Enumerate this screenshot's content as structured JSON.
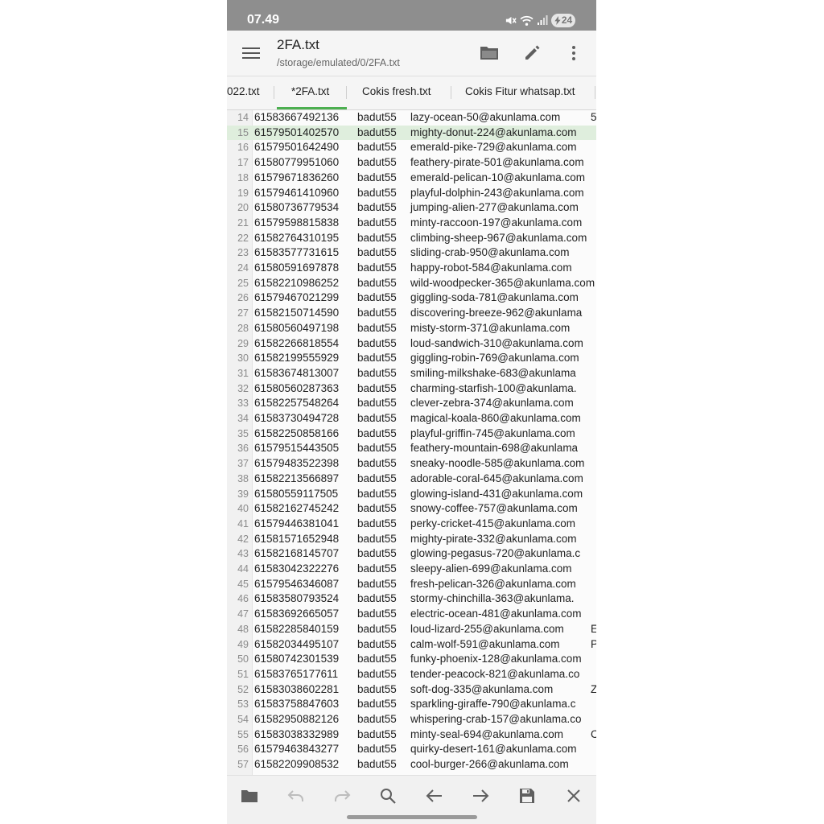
{
  "status_bar": {
    "time": "07.49",
    "battery": "24"
  },
  "app_bar": {
    "title": "2FA.txt",
    "path": "/storage/emulated/0/2FA.txt"
  },
  "tabs": [
    {
      "label": "022.txt",
      "active": false
    },
    {
      "label": "*2FA.txt",
      "active": true
    },
    {
      "label": "Cokis fresh.txt",
      "active": false
    },
    {
      "label": "Cokis Fitur whatsap.txt",
      "active": false
    }
  ],
  "editor": {
    "highlighted_line": "15",
    "lines": [
      [
        "14",
        "61583667492136",
        "badut55",
        "lazy-ocean-50@akunlama.com",
        "5"
      ],
      [
        "15",
        "61579501402570",
        "badut55",
        "mighty-donut-224@akunlama.com",
        ""
      ],
      [
        "16",
        "61579501642490",
        "badut55",
        "emerald-pike-729@akunlama.com",
        ""
      ],
      [
        "17",
        "61580779951060",
        "badut55",
        "feathery-pirate-501@akunlama.com",
        ""
      ],
      [
        "18",
        "61579671836260",
        "badut55",
        "emerald-pelican-10@akunlama.com",
        ""
      ],
      [
        "19",
        "61579461410960",
        "badut55",
        "playful-dolphin-243@akunlama.com",
        ""
      ],
      [
        "20",
        "61580736779534",
        "badut55",
        "jumping-alien-277@akunlama.com",
        ""
      ],
      [
        "21",
        "61579598815838",
        "badut55",
        "minty-raccoon-197@akunlama.com",
        ""
      ],
      [
        "22",
        "61582764310195",
        "badut55",
        "climbing-sheep-967@akunlama.com",
        ""
      ],
      [
        "23",
        "61583577731615",
        "badut55",
        "sliding-crab-950@akunlama.com",
        ""
      ],
      [
        "24",
        "61580591697878",
        "badut55",
        "happy-robot-584@akunlama.com",
        ""
      ],
      [
        "25",
        "61582210986252",
        "badut55",
        "wild-woodpecker-365@akunlama.com",
        ""
      ],
      [
        "26",
        "61579467021299",
        "badut55",
        "giggling-soda-781@akunlama.com",
        ""
      ],
      [
        "27",
        "61582150714590",
        "badut55",
        "discovering-breeze-962@akunlama",
        ""
      ],
      [
        "28",
        "61580560497198",
        "badut55",
        "misty-storm-371@akunlama.com",
        ""
      ],
      [
        "29",
        "61582266818554",
        "badut55",
        "loud-sandwich-310@akunlama.com",
        ""
      ],
      [
        "30",
        "61582199555929",
        "badut55",
        "giggling-robin-769@akunlama.com",
        ""
      ],
      [
        "31",
        "61583674813007",
        "badut55",
        "smiling-milkshake-683@akunlama",
        ""
      ],
      [
        "32",
        "61580560287363",
        "badut55",
        "charming-starfish-100@akunlama.",
        ""
      ],
      [
        "33",
        "61582257548264",
        "badut55",
        "clever-zebra-374@akunlama.com",
        ""
      ],
      [
        "34",
        "61583730494728",
        "badut55",
        "magical-koala-860@akunlama.com",
        ""
      ],
      [
        "35",
        "61582250858166",
        "badut55",
        "playful-griffin-745@akunlama.com",
        ""
      ],
      [
        "36",
        "61579515443505",
        "badut55",
        "feathery-mountain-698@akunlama",
        ""
      ],
      [
        "37",
        "61579483522398",
        "badut55",
        "sneaky-noodle-585@akunlama.com",
        ""
      ],
      [
        "38",
        "61582213566897",
        "badut55",
        "adorable-coral-645@akunlama.com",
        ""
      ],
      [
        "39",
        "61580559117505",
        "badut55",
        "glowing-island-431@akunlama.com",
        ""
      ],
      [
        "40",
        "61582162745242",
        "badut55",
        "snowy-coffee-757@akunlama.com",
        ""
      ],
      [
        "41",
        "61579446381041",
        "badut55",
        "perky-cricket-415@akunlama.com",
        ""
      ],
      [
        "42",
        "61581571652948",
        "badut55",
        "mighty-pirate-332@akunlama.com",
        ""
      ],
      [
        "43",
        "61582168145707",
        "badut55",
        "glowing-pegasus-720@akunlama.c",
        ""
      ],
      [
        "44",
        "61583042322276",
        "badut55",
        "sleepy-alien-699@akunlama.com",
        ""
      ],
      [
        "45",
        "61579546346087",
        "badut55",
        "fresh-pelican-326@akunlama.com",
        ""
      ],
      [
        "46",
        "61583580793524",
        "badut55",
        "stormy-chinchilla-363@akunlama.",
        ""
      ],
      [
        "47",
        "61583692665057",
        "badut55",
        "electric-ocean-481@akunlama.com",
        ""
      ],
      [
        "48",
        "61582285840159",
        "badut55",
        "loud-lizard-255@akunlama.com",
        "E"
      ],
      [
        "49",
        "61582034495107",
        "badut55",
        "calm-wolf-591@akunlama.com",
        "P"
      ],
      [
        "50",
        "61580742301539",
        "badut55",
        "funky-phoenix-128@akunlama.com",
        ""
      ],
      [
        "51",
        "61583765177611",
        "badut55",
        "tender-peacock-821@akunlama.co",
        ""
      ],
      [
        "52",
        "61583038602281",
        "badut55",
        "soft-dog-335@akunlama.com",
        "ZU"
      ],
      [
        "53",
        "61583758847603",
        "badut55",
        "sparkling-giraffe-790@akunlama.c",
        ""
      ],
      [
        "54",
        "61582950882126",
        "badut55",
        "whispering-crab-157@akunlama.co",
        ""
      ],
      [
        "55",
        "61583038332989",
        "badut55",
        "minty-seal-694@akunlama.com",
        "C"
      ],
      [
        "56",
        "61579463843277",
        "badut55",
        "quirky-desert-161@akunlama.com",
        ""
      ],
      [
        "57",
        "61582209908532",
        "badut55",
        "cool-burger-266@akunlama.com",
        ""
      ]
    ]
  },
  "bottom_bar": {
    "icons": [
      "folder-icon",
      "undo-icon",
      "redo-icon",
      "search-icon",
      "arrow-left-icon",
      "arrow-right-icon",
      "save-icon",
      "close-icon"
    ]
  },
  "colors": {
    "status_bar": "#8e8e8e",
    "accent": "#4caf50",
    "highlight": "#dfeedd",
    "icon": "#5f5f5f"
  }
}
